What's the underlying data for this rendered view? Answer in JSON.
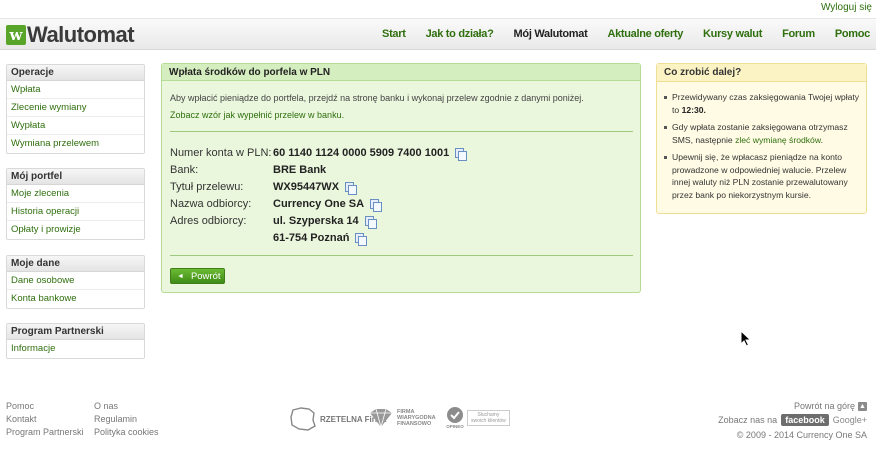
{
  "top": {
    "logout": "Wyloguj się"
  },
  "logo": {
    "mark": "w",
    "name": "Walutomat"
  },
  "nav": [
    "Start",
    "Jak to działa?",
    "Mój Walutomat",
    "Aktualne oferty",
    "Kursy walut",
    "Forum",
    "Pomoc"
  ],
  "sidebar": {
    "operacje": {
      "title": "Operacje",
      "items": [
        "Wpłata",
        "Zlecenie wymiany",
        "Wypłata",
        "Wymiana przelewem"
      ]
    },
    "portfel": {
      "title": "Mój portfel",
      "items": [
        "Moje zlecenia",
        "Historia operacji",
        "Opłaty i prowizje"
      ]
    },
    "dane": {
      "title": "Moje dane",
      "items": [
        "Dane osobowe",
        "Konta bankowe"
      ]
    },
    "partner": {
      "title": "Program Partnerski",
      "items": [
        "Informacje"
      ]
    }
  },
  "main": {
    "title": "Wpłata środków do porfela w PLN",
    "intro": "Aby wpłacić pieniądze do portfela, przejdź na stronę banku i wykonaj przelew zgodnie z danymi poniżej.",
    "sample_link": "Zobacz wzór jak wypełnić przelew w banku.",
    "fields": [
      {
        "label": "Numer konta w PLN:",
        "value": "60 1140 1124 0000 5909 7400 1001",
        "copy": true
      },
      {
        "label": "Bank:",
        "value": "BRE Bank",
        "copy": false
      },
      {
        "label": "Tytuł przelewu:",
        "value": "WX95447WX",
        "copy": true
      },
      {
        "label": "Nazwa odbiorcy:",
        "value": "Currency One SA",
        "copy": true
      },
      {
        "label": "Adres odbiorcy:",
        "value": "ul. Szyperska 14",
        "copy": true
      },
      {
        "label": "",
        "value": "61-754 Poznań",
        "copy": true
      }
    ],
    "back_button": "Powrót",
    "back_icon": "◄"
  },
  "help": {
    "title": "Co zrobić dalej?",
    "items": [
      {
        "before": "Przewidywany czas zaksięgowania Twojej wpłaty to ",
        "bold": "12:30.",
        "link": "",
        "after": ""
      },
      {
        "before": "Gdy wpłata zostanie zaksięgowana otrzymasz SMS, następnie ",
        "bold": "",
        "link": "zleć wymianę środków",
        "after": "."
      },
      {
        "before": "Upewnij się, że wpłacasz pieniądze na konto prowadzone w odpowiedniej walucie. Przelew innej waluty niż PLN zostanie przewalutowany przez bank po niekorzystnym kursie.",
        "bold": "",
        "link": "",
        "after": ""
      }
    ]
  },
  "footer": {
    "col1": [
      "Pomoc",
      "Kontakt",
      "Program Partnerski"
    ],
    "col2": [
      "O nas",
      "Regulamin",
      "Polityka cookies"
    ],
    "badges": {
      "rzetelna": "RZETELNA Firma",
      "wiarygodna_1": "FIRMA",
      "wiarygodna_2": "WIARYGODNA",
      "wiarygodna_3": "FINANSOWO",
      "opineo_1": "Słuchamy",
      "opineo_2": "swoich klientów",
      "opineo_3": "OPINEO"
    },
    "back_to_top": "Powrót na górę",
    "see_us_on": "Zobacz nas na",
    "facebook": "facebook",
    "google": "Google+",
    "copyright": "© 2009 - 2014 Currency One SA"
  },
  "icons": {
    "copy": "copy-icon",
    "cursor": "mouse-cursor-icon",
    "up": "arrow-up-icon"
  },
  "colors": {
    "accent_green": "#2f6f0e",
    "panel_green": "#eaf7dd",
    "help_yellow": "#fffbe4",
    "logo_green": "#58a52a"
  }
}
